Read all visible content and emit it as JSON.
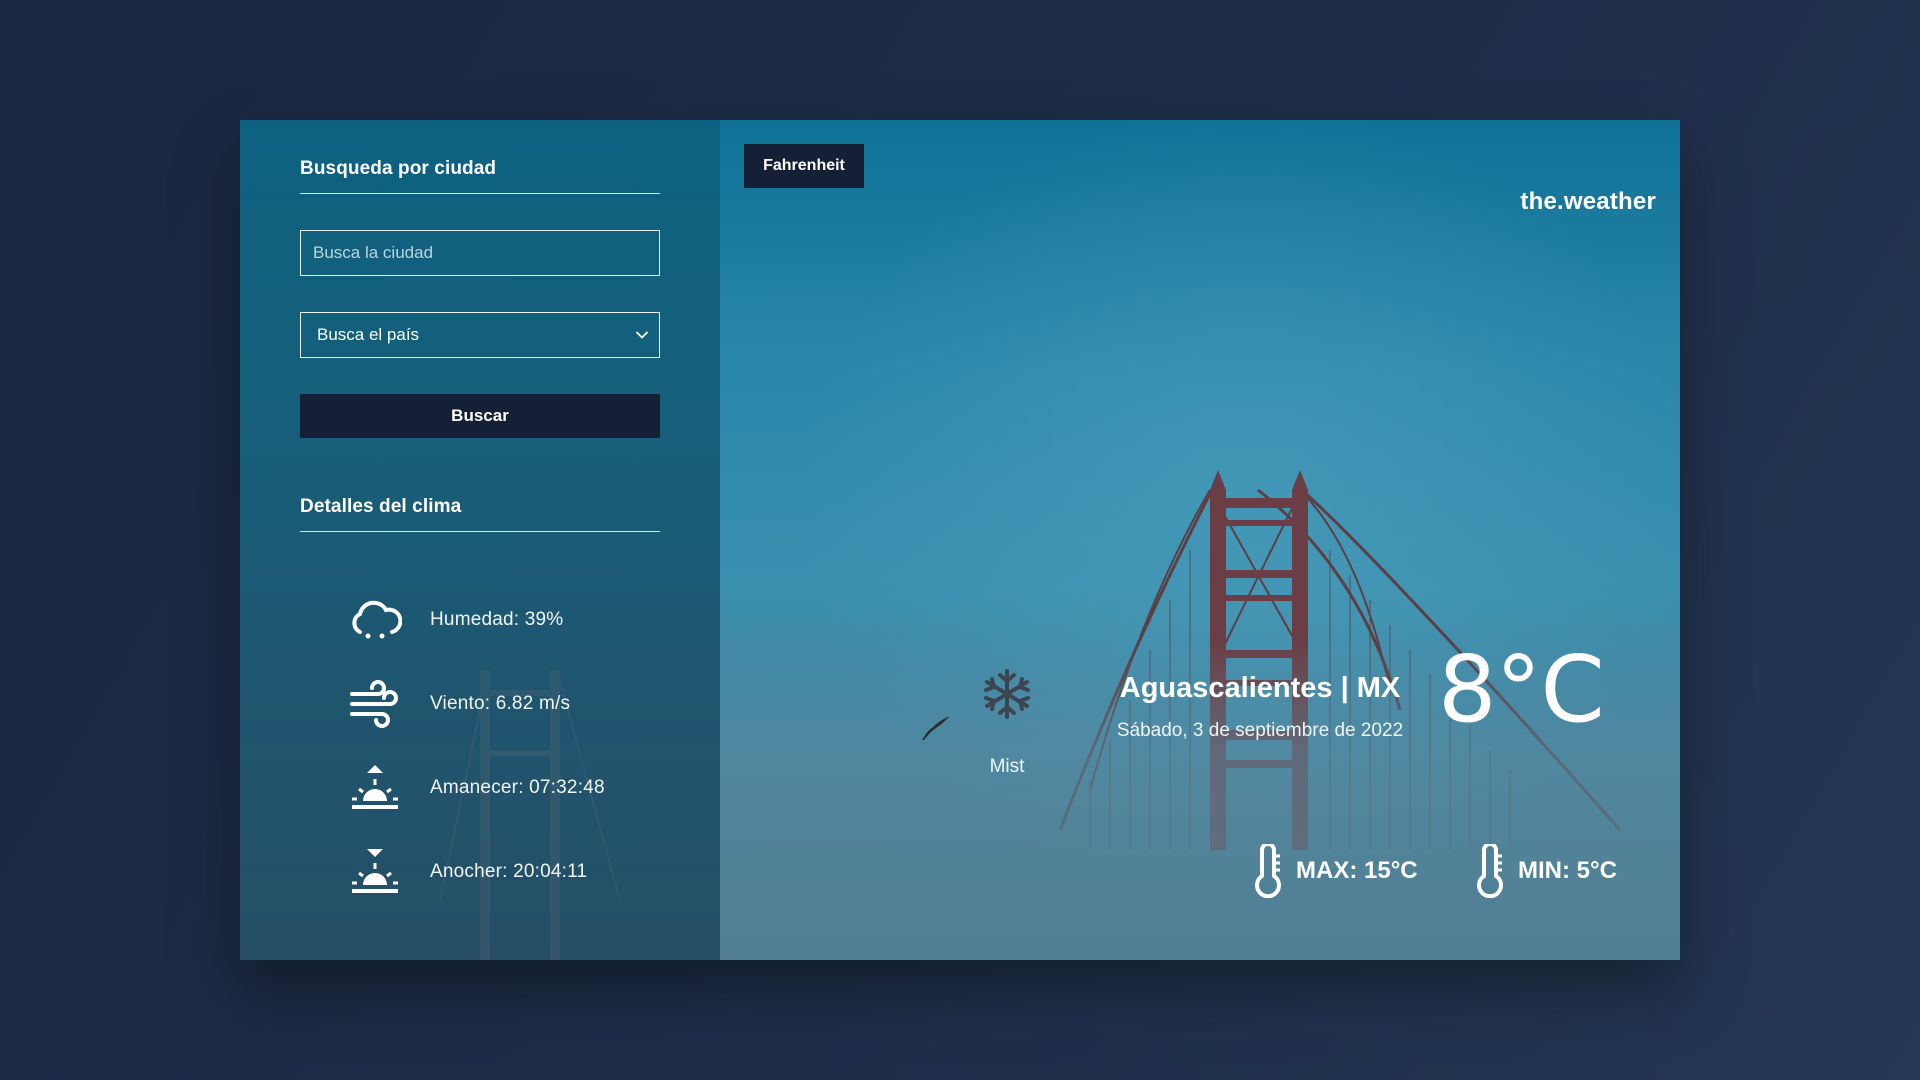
{
  "sidebar": {
    "search_title": "Busqueda por ciudad",
    "city_placeholder": "Busca la ciudad",
    "country_select_value": "Busca el país",
    "search_button": "Buscar",
    "details_title": "Detalles del clima",
    "details": [
      {
        "icon": "humidity-cloud-icon",
        "text": "Humedad: 39%"
      },
      {
        "icon": "wind-icon",
        "text": "Viento: 6.82 m/s"
      },
      {
        "icon": "sunrise-icon",
        "text": "Amanecer: 07:32:48"
      },
      {
        "icon": "sunset-icon",
        "text": "Anocher: 20:04:11"
      }
    ]
  },
  "main": {
    "unit_button": "Fahrenheit",
    "brand": "the.weather",
    "condition_icon": "snowflake-icon",
    "condition": "Mist",
    "location": "Aguascalientes | MX",
    "date": "Sábado, 3 de septiembre de 2022",
    "temperature": "8°C",
    "max": "MAX: 15°C",
    "min": "MIN: 5°C"
  },
  "colors": {
    "page_background": "#1e2d48",
    "button_dark": "#152036",
    "sidebar_top": "#0d6180",
    "main_sky": "#2a88ab"
  }
}
